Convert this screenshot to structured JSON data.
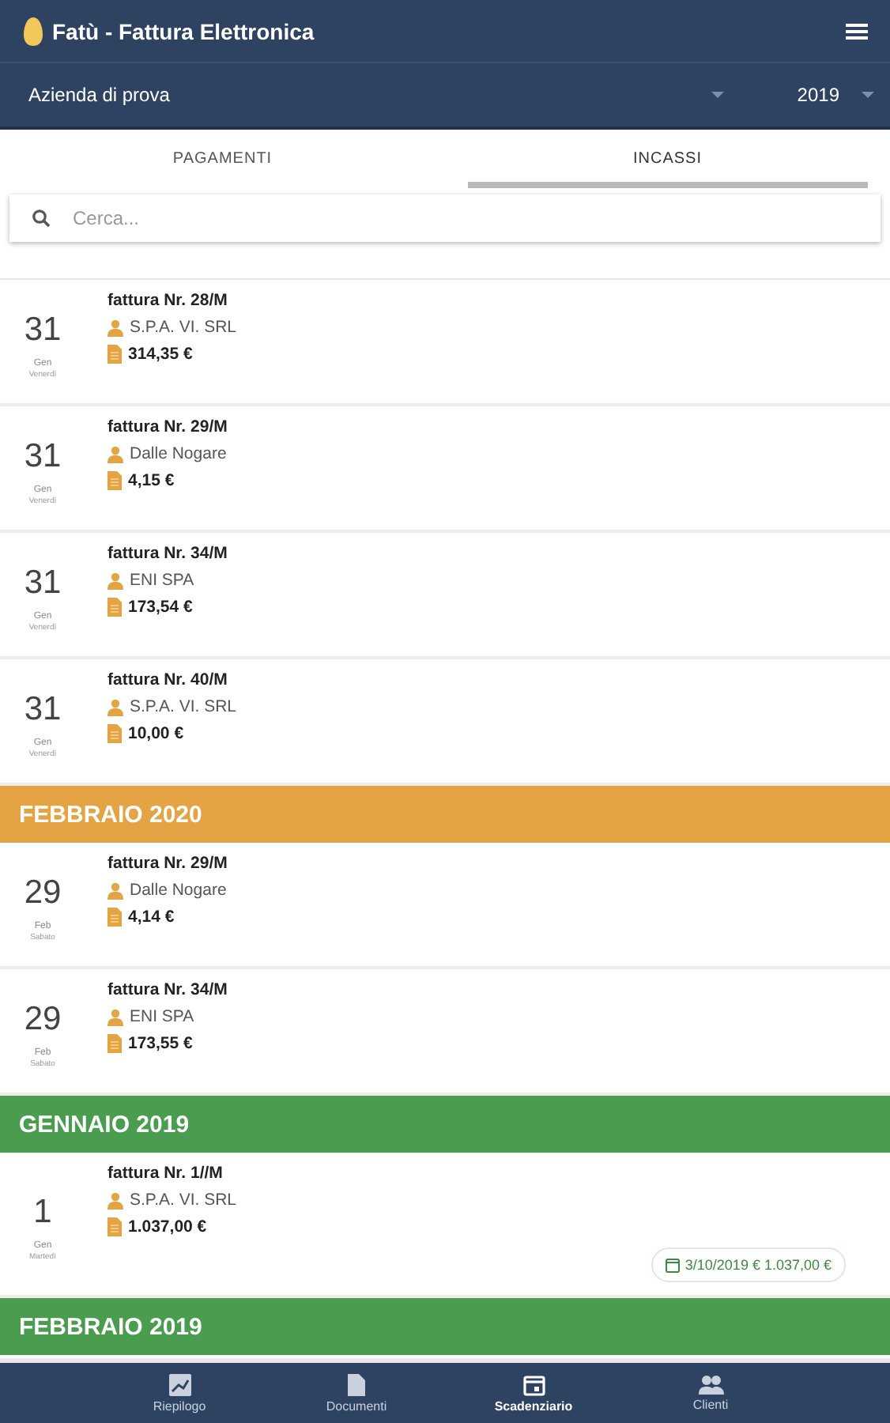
{
  "app_bar": {
    "title": "Fatù - Fattura Elettronica"
  },
  "filters": {
    "company": "Azienda di prova",
    "year": "2019"
  },
  "tabs": [
    {
      "label": "PAGAMENTI",
      "selected": false
    },
    {
      "label": "INCASSI",
      "selected": true
    }
  ],
  "search": {
    "placeholder": "Cerca..."
  },
  "sections": [
    {
      "items": [
        {
          "day": "31",
          "month": "Gen",
          "weekday": "Venerdì",
          "title": "fattura Nr. 28/M",
          "client": "S.P.A. VI. SRL",
          "amount": "314,35 €"
        },
        {
          "day": "31",
          "month": "Gen",
          "weekday": "Venerdì",
          "title": "fattura Nr. 29/M",
          "client": "Dalle Nogare",
          "amount": "4,15 €"
        },
        {
          "day": "31",
          "month": "Gen",
          "weekday": "Venerdì",
          "title": "fattura Nr. 34/M",
          "client": "ENI SPA",
          "amount": "173,54 €"
        },
        {
          "day": "31",
          "month": "Gen",
          "weekday": "Venerdì",
          "title": "fattura Nr. 40/M",
          "client": "S.P.A. VI. SRL",
          "amount": "10,00 €"
        }
      ]
    },
    {
      "title": "FEBBRAIO 2020",
      "color": "#e5a443",
      "items": [
        {
          "day": "29",
          "month": "Feb",
          "weekday": "Sabato",
          "title": "fattura Nr. 29/M",
          "client": "Dalle Nogare",
          "amount": "4,14 €"
        },
        {
          "day": "29",
          "month": "Feb",
          "weekday": "Sabato",
          "title": "fattura Nr. 34/M",
          "client": "ENI SPA",
          "amount": "173,55 €"
        }
      ]
    },
    {
      "title": "GENNAIO 2019",
      "color": "#4a9d4f",
      "items": [
        {
          "day": "1",
          "month": "Gen",
          "weekday": "Martedì",
          "title": "fattura Nr. 1//M",
          "client": "S.P.A. VI. SRL",
          "amount": "1.037,00 €",
          "payment": "3/10/2019 € 1.037,00 €"
        }
      ]
    },
    {
      "title": "FEBBRAIO 2019",
      "color": "#4a9d4f"
    }
  ],
  "bottom_nav": [
    {
      "label": "Riepilogo",
      "kind": "chart",
      "selected": false
    },
    {
      "label": "Documenti",
      "kind": "doc",
      "selected": false
    },
    {
      "label": "Scadenziario",
      "kind": "calendar",
      "selected": true
    },
    {
      "label": "Clienti",
      "kind": "people",
      "selected": false
    }
  ]
}
